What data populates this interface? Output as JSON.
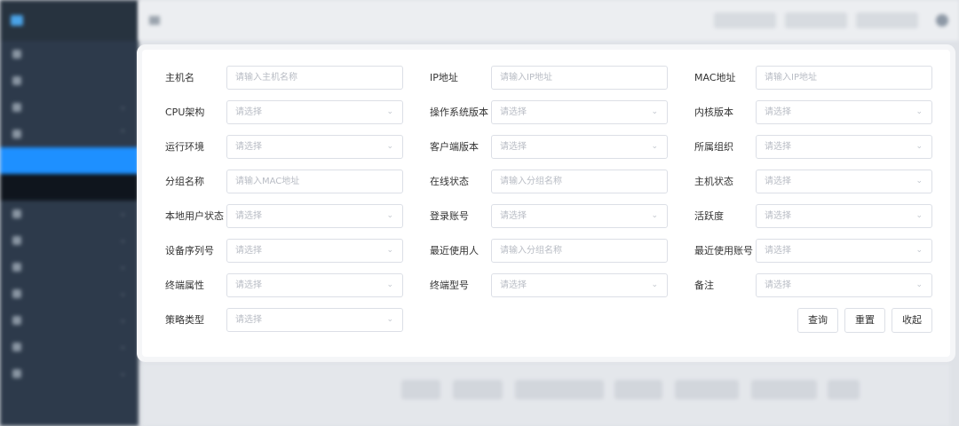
{
  "form": {
    "col1": [
      {
        "label": "主机名",
        "kind": "input",
        "placeholder": "请输入主机名称"
      },
      {
        "label": "CPU架构",
        "kind": "select",
        "placeholder": "请选择"
      },
      {
        "label": "运行环境",
        "kind": "select",
        "placeholder": "请选择"
      },
      {
        "label": "分组名称",
        "kind": "input",
        "placeholder": "请输入MAC地址"
      },
      {
        "label": "本地用户状态",
        "kind": "select",
        "placeholder": "请选择"
      },
      {
        "label": "设备序列号",
        "kind": "select",
        "placeholder": "请选择"
      },
      {
        "label": "终端属性",
        "kind": "select",
        "placeholder": "请选择"
      },
      {
        "label": "策略类型",
        "kind": "select",
        "placeholder": "请选择"
      }
    ],
    "col2": [
      {
        "label": "IP地址",
        "kind": "input",
        "placeholder": "请输入IP地址"
      },
      {
        "label": "操作系统版本",
        "kind": "select",
        "placeholder": "请选择"
      },
      {
        "label": "客户端版本",
        "kind": "select",
        "placeholder": "请选择"
      },
      {
        "label": "在线状态",
        "kind": "input",
        "placeholder": "请输入分组名称"
      },
      {
        "label": "登录账号",
        "kind": "select",
        "placeholder": "请选择"
      },
      {
        "label": "最近使用人",
        "kind": "input",
        "placeholder": "请输入分组名称"
      },
      {
        "label": "终端型号",
        "kind": "select",
        "placeholder": "请选择"
      }
    ],
    "col3": [
      {
        "label": "MAC地址",
        "kind": "input",
        "placeholder": "请输入IP地址"
      },
      {
        "label": "内核版本",
        "kind": "select",
        "placeholder": "请选择"
      },
      {
        "label": "所属组织",
        "kind": "select",
        "placeholder": "请选择"
      },
      {
        "label": "主机状态",
        "kind": "select",
        "placeholder": "请选择"
      },
      {
        "label": "活跃度",
        "kind": "select",
        "placeholder": "请选择"
      },
      {
        "label": "最近使用账号",
        "kind": "select",
        "placeholder": "请选择"
      },
      {
        "label": "备注",
        "kind": "select",
        "placeholder": "请选择"
      }
    ],
    "buttons": {
      "query": "查询",
      "reset": "重置",
      "collapse": "收起"
    }
  },
  "icons": {
    "select_caret": "chevron-down-icon"
  },
  "colors": {
    "sidebar_bg": "#2d3a4b",
    "sidebar_active": "#1e90ff",
    "border": "#dcdfe6",
    "placeholder": "#b8bcc4"
  }
}
